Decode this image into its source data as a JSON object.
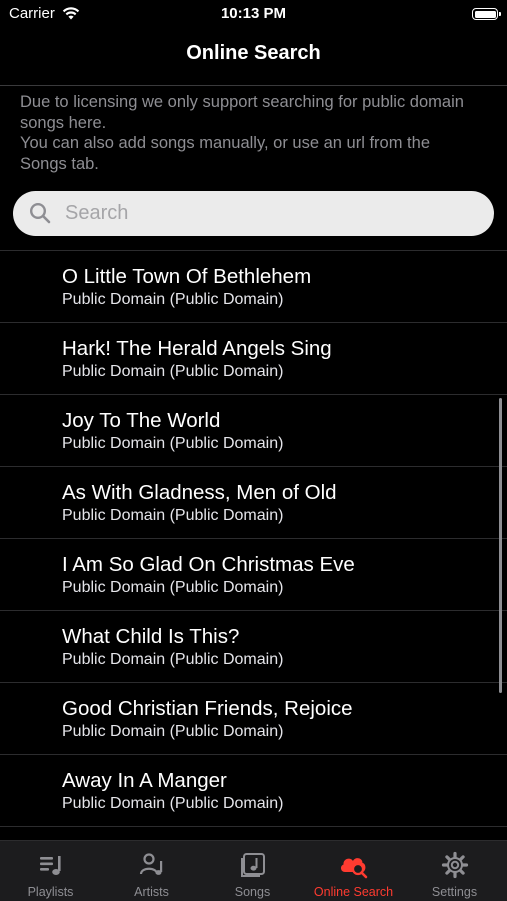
{
  "status_bar": {
    "carrier": "Carrier",
    "time": "10:13 PM"
  },
  "nav": {
    "title": "Online Search"
  },
  "info": {
    "line1": "Due to licensing we only support searching for public domain songs here.",
    "line2": "You can also add songs manually, or use an url from the Songs tab."
  },
  "search": {
    "placeholder": "Search",
    "value": ""
  },
  "songs": [
    {
      "title": "O Little Town Of Bethlehem",
      "subtitle": "Public Domain (Public Domain)"
    },
    {
      "title": "Hark! The Herald Angels Sing",
      "subtitle": "Public Domain (Public Domain)"
    },
    {
      "title": "Joy To The World",
      "subtitle": "Public Domain (Public Domain)"
    },
    {
      "title": "As With Gladness, Men of Old",
      "subtitle": "Public Domain (Public Domain)"
    },
    {
      "title": "I Am So Glad On Christmas Eve",
      "subtitle": "Public Domain (Public Domain)"
    },
    {
      "title": "What Child Is This?",
      "subtitle": "Public Domain (Public Domain)"
    },
    {
      "title": "Good Christian Friends, Rejoice",
      "subtitle": "Public Domain (Public Domain)"
    },
    {
      "title": "Away In A Manger",
      "subtitle": "Public Domain (Public Domain)"
    }
  ],
  "tabs": [
    {
      "label": "Playlists",
      "icon": "playlist-icon",
      "active": false
    },
    {
      "label": "Artists",
      "icon": "artists-icon",
      "active": false
    },
    {
      "label": "Songs",
      "icon": "songs-icon",
      "active": false
    },
    {
      "label": "Online Search",
      "icon": "cloud-search-icon",
      "active": true
    },
    {
      "label": "Settings",
      "icon": "gear-icon",
      "active": false
    }
  ],
  "colors": {
    "accent": "#ff3b30",
    "inactive": "#8e8e93",
    "background": "#000000",
    "tabbar": "#1c1c1e"
  }
}
